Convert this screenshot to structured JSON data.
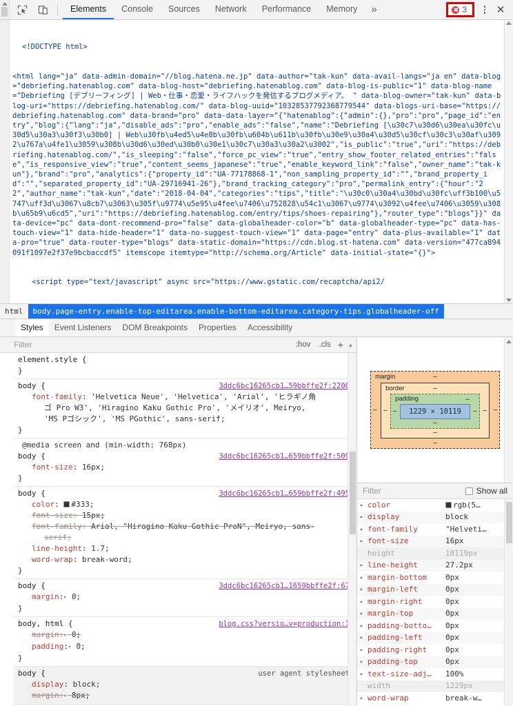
{
  "toolbar": {
    "icons": [
      {
        "name": "inspect-element-icon",
        "label": "Inspect element"
      },
      {
        "name": "device-toolbar-icon",
        "label": "Toggle device toolbar"
      }
    ],
    "tabs": [
      {
        "label": "Elements",
        "active": true
      },
      {
        "label": "Console",
        "active": false
      },
      {
        "label": "Sources",
        "active": false
      },
      {
        "label": "Network",
        "active": false
      },
      {
        "label": "Performance",
        "active": false
      },
      {
        "label": "Memory",
        "active": false
      }
    ],
    "more_tabs_label": "»",
    "error_count": "3",
    "menu_label": "⋮",
    "close_label": "✕",
    "accent_color": "#1a73e8",
    "error_color": "#e03a3a",
    "highlight_box_color": "#e10000"
  },
  "dom": {
    "lines": [
      {
        "indent": 1,
        "text": "<!DOCTYPE html>"
      },
      {
        "indent": 0,
        "text": "<html lang=\"ja\" data-admin-domain=\"//blog.hatena.ne.jp\" data-author=\"tak-kun\" data-avail-langs=\"ja en\" data-blog=\"debriefing.hatenablog.com\" data-blog-host=\"debriefing.hatenablog.com\" data-blog-is-public=\"1\" data-blog-name=\"Debriefing [デブリーフィング] | Web・仕事・恋愛・ライフハックを発信するブログメディア。 \" data-blog-owner=\"tak-kun\" data-blog-uri=\"https://debriefing.hatenablog.com/\" data-blog-uuid=\"10328537792368779544\" data-blogs-uri-base=\"https://debriefing.hatenablog.com\" data-brand=\"pro\" data-data-layer=\"{\"hatenablog\":{\"admin\":{},\"pro\":\"pro\",\"page_id\":\"entry\",\"blog\":{\"lang\":\"ja\",\"disable_ads\":\"pro\",\"enable_ads\":\"false\",\"name\":\"Debriefing [\\u30c7\\u30d6\\u30ea\\u30fc\\u30d5\\u30a3\\u30f3\\u30b0] | Web\\u30fb\\u4ed5\\u4e8b\\u30fb\\u604b\\u611b\\u30fb\\u30e9\\u30a4\\u30d5\\u30cf\\u30c3\\u30af\\u3092\\u767a\\u4fe1\\u3059\\u308b\\u30d6\\u30ed\\u30b0\\u30e1\\u30c7\\u30a3\\u30a2\\u3002\",\"is_public\":\"true\",\"uri\":\"https://debriefing.hatenablog.com/\",\"is_sleeping\":\"false\",\"force_pc_view\":\"true\",\"entry_show_footer_related_entries\":\"false\",\"is_responsive_view\":\"true\",\"content_seems_japanese\":\"true\",\"enable_keyword_link\":\"false\",\"owner_name\":\"tak-kun\"},\"brand\":\"pro\",\"analytics\":{\"property_id\":\"UA-77178868-1\",\"non_sampling_property_id\":\"\",\"brand_property_id\":\"\",\"separated_property_id\":\"UA-29716941-26\"},\"brand_tracking_category\":\"pro\",\"permalink_entry\":{\"hour\":\"22\",\"author_name\":\"tak-kun\",\"date\":\"2018-04-04\",\"categories\":\"tips\",\"title\":\"\\u30c0\\u30a4\\u30bd\\u30fc\\uff3b100\\u5747\\uff3d\\u3067\\u8cb7\\u3063\\u305f\\u9774\\u5e95\\u4fee\\u7406\\u752828\\u54c1\\u3067\\u9774\\u3092\\u4fee\\u7406\\u3059\\u308b\\u65b9\\u6cd5\",\"uri\":\"https://debriefing.hatenablog.com/entry/tips/shoes-repairing\"},\"router_type\":\"blogs\"}}\" data-device=\"pc\" data-dont-recommend-pro=\"false\" data-globalheader-color=\"b\" data-globalheader-type=\"pc\" data-has-touch-view=\"1\" data-hide-header=\"1\" data-no-suggest-touch-view=\"1\" data-page=\"entry\" data-plus-available=\"1\" data-pro=\"true\" data-router-type=\"blogs\" data-static-domain=\"https://cdn.blog.st-hatena.com\" data-version=\"477ca894091f1097e2f37e9bcbaccdf5\" itemscope itemtype=\"http://schema.org/Article\" data-initial-state=\"{}\">"
      },
      {
        "indent": 2,
        "text": "<script type=\"text/javascript\" async src=\"https://www.gstatic.com/recaptcha/api2/"
      }
    ]
  },
  "breadcrumb": {
    "items": [
      {
        "label": "html",
        "selected": false
      },
      {
        "label": "body.page-entry.enable-top-editarea.enable-bottom-editarea.category-tips.globalheader-off",
        "selected": true
      }
    ]
  },
  "sidebar_tabs": [
    {
      "label": "Styles",
      "active": true
    },
    {
      "label": "Event Listeners",
      "active": false
    },
    {
      "label": "DOM Breakpoints",
      "active": false
    },
    {
      "label": "Properties",
      "active": false
    },
    {
      "label": "Accessibility",
      "active": false
    }
  ],
  "styles": {
    "filter_placeholder": "Filter",
    "hov_label": ":hov",
    "cls_label": ".cls",
    "new_rule_label": "+",
    "rules": [
      {
        "selector": "element.style {",
        "origin": "",
        "origin_link": false,
        "declarations": [],
        "close": "}"
      },
      {
        "selector": "body {",
        "origin": "3ddc6bc16265cb1…59bbffe2f:2200",
        "origin_link": true,
        "declarations": [
          {
            "prop": "font-family",
            "value": "'Helvetica Neue', 'Helvetica', 'Arial', 'ヒラギノ角",
            "struck": false,
            "continuations": [
              "ゴ Pro W3', 'Hiragino Kaku Gothic Pro', 'メイリオ', Meiryo,",
              "'MS Pゴシック', 'MS PGothic', sans-serif;"
            ]
          }
        ],
        "close": "}"
      },
      {
        "media": "@media screen and (min-width: 768px)",
        "selector": "body {",
        "origin": "3ddc6bc16265cb1…659bbffe2f:509",
        "origin_link": true,
        "declarations": [
          {
            "prop": "font-size",
            "value": "16px;",
            "struck": false,
            "continuations": []
          }
        ],
        "close": "}"
      },
      {
        "selector": "body {",
        "origin": "3ddc6bc16265cb1…659bbffe2f:495",
        "origin_link": true,
        "declarations": [
          {
            "prop": "color",
            "value": "#333;",
            "struck": false,
            "swatch": "#333333",
            "continuations": []
          },
          {
            "prop": "font-size",
            "value": "15px;",
            "struck": true,
            "continuations": []
          },
          {
            "prop": "font-family",
            "value": "Arial, \"Hiragino Kaku Gothic ProN\", Meiryo, sans-",
            "struck": true,
            "continuations": [
              "serif;"
            ]
          },
          {
            "prop": "line-height",
            "value": "1.7;",
            "struck": false,
            "continuations": []
          },
          {
            "prop": "word-wrap",
            "value": "break-word;",
            "struck": false,
            "continuations": []
          }
        ],
        "close": "}"
      },
      {
        "selector": "body {",
        "origin": "3ddc6bc16265cb1…1659bbffe2f:67",
        "origin_link": true,
        "declarations": [
          {
            "prop": "margin",
            "value": "0;",
            "struck": false,
            "expandable": true,
            "continuations": []
          }
        ],
        "close": "}"
      },
      {
        "selector": "body, html {",
        "origin": "blog.css?versio…v=production:1",
        "origin_link": true,
        "declarations": [
          {
            "prop": "margin",
            "value": "0;",
            "struck": true,
            "expandable": true,
            "continuations": []
          },
          {
            "prop": "padding",
            "value": "0;",
            "struck": false,
            "expandable": true,
            "continuations": []
          }
        ],
        "close": "}"
      },
      {
        "selector": "body {",
        "origin": "user agent stylesheet",
        "origin_link": false,
        "ua": true,
        "declarations": [
          {
            "prop": "display",
            "value": "block;",
            "struck": false,
            "continuations": []
          },
          {
            "prop": "margin",
            "value": "8px;",
            "struck": true,
            "expandable": true,
            "continuations": []
          }
        ],
        "close": ""
      }
    ]
  },
  "box_model": {
    "margin_label": "margin",
    "border_label": "border",
    "padding_label": "padding",
    "content_size": "1229 × 10119",
    "dash": "–",
    "colors": {
      "margin": "#f9cb9c",
      "border": "#fde2b9",
      "padding": "#b6d7a8",
      "content": "#a4c2e0"
    }
  },
  "computed": {
    "filter_placeholder": "Filter",
    "show_all_label": "Show all",
    "show_all_checked": false,
    "rows": [
      {
        "prop": "color",
        "value": "rgb(5…",
        "expandable": true,
        "inherited": false,
        "swatch": "#333333"
      },
      {
        "prop": "display",
        "value": "block",
        "expandable": true,
        "inherited": false
      },
      {
        "prop": "font-family",
        "value": "\"Helveti…",
        "expandable": true,
        "inherited": false
      },
      {
        "prop": "font-size",
        "value": "16px",
        "expandable": true,
        "inherited": false
      },
      {
        "prop": "height",
        "value": "10119px",
        "expandable": false,
        "inherited": true
      },
      {
        "prop": "line-height",
        "value": "27.2px",
        "expandable": true,
        "inherited": false
      },
      {
        "prop": "margin-bottom",
        "value": "0px",
        "expandable": true,
        "inherited": false
      },
      {
        "prop": "margin-left",
        "value": "0px",
        "expandable": true,
        "inherited": false
      },
      {
        "prop": "margin-right",
        "value": "0px",
        "expandable": true,
        "inherited": false
      },
      {
        "prop": "margin-top",
        "value": "0px",
        "expandable": true,
        "inherited": false
      },
      {
        "prop": "padding-botto…",
        "value": "0px",
        "expandable": true,
        "inherited": false
      },
      {
        "prop": "padding-left",
        "value": "0px",
        "expandable": true,
        "inherited": false
      },
      {
        "prop": "padding-right",
        "value": "0px",
        "expandable": true,
        "inherited": false
      },
      {
        "prop": "padding-top",
        "value": "0px",
        "expandable": true,
        "inherited": false
      },
      {
        "prop": "text-size-adj…",
        "value": "100%",
        "expandable": true,
        "inherited": false
      },
      {
        "prop": "width",
        "value": "1229px",
        "expandable": false,
        "inherited": true
      },
      {
        "prop": "word-wrap",
        "value": "break-w…",
        "expandable": true,
        "inherited": false
      }
    ]
  }
}
